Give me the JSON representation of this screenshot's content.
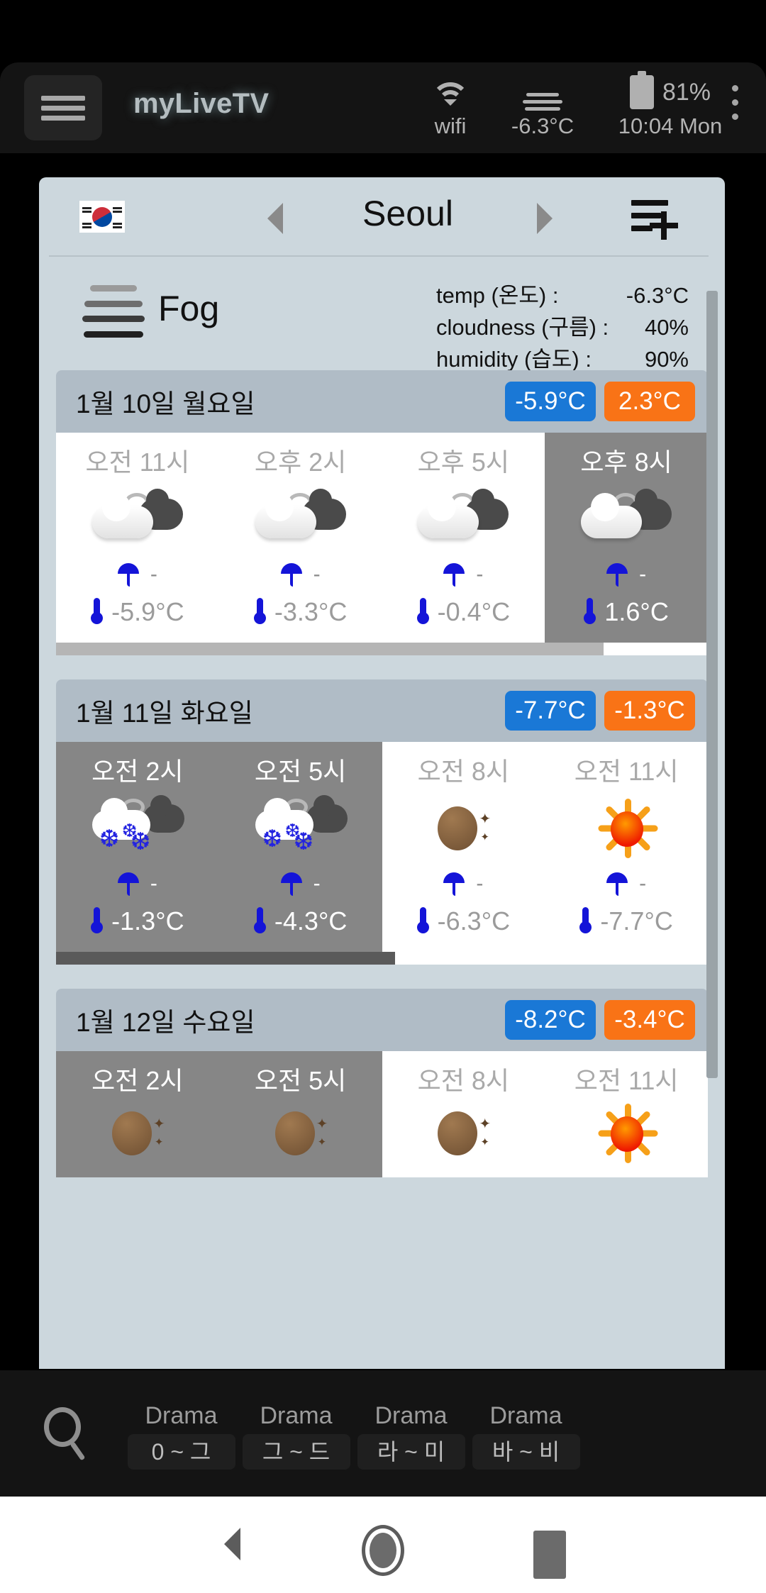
{
  "app": {
    "title": "myLiveTV",
    "menu_icon": "hamburger-icon",
    "overflow_icon": "more-vertical-icon"
  },
  "status_bar": {
    "wifi_icon": "wifi-icon",
    "wifi_label": "wifi",
    "weather_icon": "fog-icon",
    "weather_label": "-6.3°C",
    "battery_icon": "battery-icon",
    "battery_level": "81%",
    "clock": "10:04 Mon"
  },
  "weather": {
    "flag_icon": "south-korea-flag-icon",
    "prev_icon": "triangle-left-icon",
    "next_icon": "triangle-right-icon",
    "city": "Seoul",
    "add_city_icon": "add-to-list-icon",
    "current": {
      "condition_icon": "fog-icon",
      "condition": "Fog",
      "stats": [
        {
          "key": "temp (온도) :",
          "value": "-6.3°C"
        },
        {
          "key": "cloudness (구름) :",
          "value": "40%"
        },
        {
          "key": "humidity (습도) :",
          "value": "90%"
        }
      ]
    },
    "days": [
      {
        "title": "1월 10일 월요일",
        "min": "-5.9°C",
        "max": "2.3°C",
        "hours": [
          {
            "time": "오전 11시",
            "icon": "cloud-sun-icon",
            "rain": "-",
            "temp": "-5.9°C",
            "night": false
          },
          {
            "time": "오후 2시",
            "icon": "cloud-sun-icon",
            "rain": "-",
            "temp": "-3.3°C",
            "night": false
          },
          {
            "time": "오후 5시",
            "icon": "cloud-sun-icon",
            "rain": "-",
            "temp": "-0.4°C",
            "night": false
          },
          {
            "time": "오후 8시",
            "icon": "cloud-sun-icon",
            "rain": "-",
            "temp": "1.6°C",
            "night": true
          }
        ],
        "hscroll_pct": 84,
        "hscroll_dark": false
      },
      {
        "title": "1월 11일 화요일",
        "min": "-7.7°C",
        "max": "-1.3°C",
        "hours": [
          {
            "time": "오전 2시",
            "icon": "snow-cloud-icon",
            "rain": "-",
            "temp": "-1.3°C",
            "night": true
          },
          {
            "time": "오전 5시",
            "icon": "snow-cloud-icon",
            "rain": "-",
            "temp": "-4.3°C",
            "night": true
          },
          {
            "time": "오전 8시",
            "icon": "moon-icon",
            "rain": "-",
            "temp": "-6.3°C",
            "night": false
          },
          {
            "time": "오전 11시",
            "icon": "sun-icon",
            "rain": "-",
            "temp": "-7.7°C",
            "night": false
          }
        ],
        "hscroll_pct": 52,
        "hscroll_dark": true
      },
      {
        "title": "1월 12일 수요일",
        "min": "-8.2°C",
        "max": "-3.4°C",
        "hours": [
          {
            "time": "오전 2시",
            "icon": "moon-icon",
            "rain": "",
            "temp": "",
            "night": true
          },
          {
            "time": "오전 5시",
            "icon": "moon-icon",
            "rain": "",
            "temp": "",
            "night": true
          },
          {
            "time": "오전 8시",
            "icon": "moon-icon",
            "rain": "",
            "temp": "",
            "night": false
          },
          {
            "time": "오전 11시",
            "icon": "sun-icon",
            "rain": "",
            "temp": "",
            "night": false
          }
        ],
        "hscroll_pct": 0,
        "hscroll_dark": false
      }
    ]
  },
  "bottom_nav": {
    "search_icon": "search-icon",
    "tabs": [
      {
        "label": "Drama",
        "range": "0 ~ 그"
      },
      {
        "label": "Drama",
        "range": "그 ~ 드"
      },
      {
        "label": "Drama",
        "range": "라 ~ 미"
      },
      {
        "label": "Drama",
        "range": "바 ~ 비"
      }
    ]
  },
  "android_nav": {
    "back_icon": "back-triangle-icon",
    "home_icon": "home-circle-icon",
    "recents_icon": "recents-square-icon"
  },
  "colors": {
    "panel_bg": "#ccd7dd",
    "day_head_bg": "#b0bcc6",
    "min_pill": "#1a78d6",
    "max_pill": "#f97316",
    "night_cell": "#868686"
  }
}
